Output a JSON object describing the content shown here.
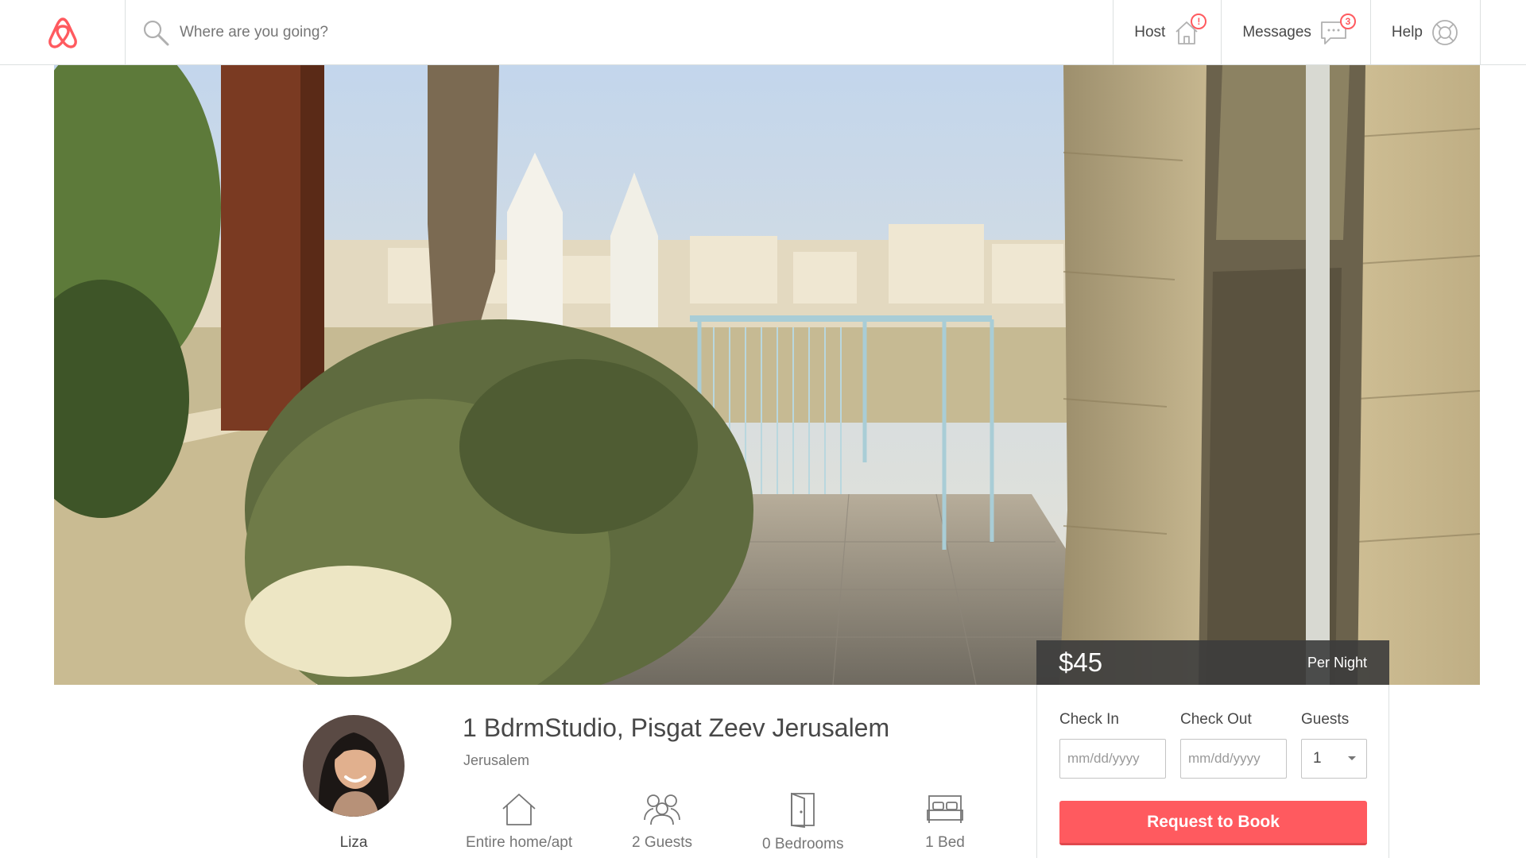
{
  "header": {
    "logo_icon": "airbnb-belo-icon",
    "search": {
      "placeholder": "Where are you going?",
      "value": "",
      "icon": "search-icon"
    },
    "nav": {
      "host": {
        "label": "Host",
        "icon": "house-icon",
        "badge": "!"
      },
      "messages": {
        "label": "Messages",
        "icon": "speech-bubble-icon",
        "badge": "3"
      },
      "help": {
        "label": "Help",
        "icon": "lifebuoy-icon"
      }
    }
  },
  "listing": {
    "title": "1 BdrmStudio, Pisgat Zeev Jerusalem",
    "location": "Jerusalem",
    "host_name": "Liza",
    "amenities": [
      {
        "label": "Entire home/apt",
        "icon": "home-icon"
      },
      {
        "label": "2 Guests",
        "icon": "guests-icon"
      },
      {
        "label": "0 Bedrooms",
        "icon": "door-icon"
      },
      {
        "label": "1 Bed",
        "icon": "bed-icon"
      }
    ]
  },
  "booking": {
    "price": "$45",
    "per_night": "Per Night",
    "check_in_label": "Check In",
    "check_out_label": "Check Out",
    "guests_label": "Guests",
    "date_placeholder": "mm/dd/yyyy",
    "guests_value": "1",
    "book_button": "Request to Book"
  },
  "colors": {
    "brand": "#ff5a5f",
    "text": "#484848",
    "muted": "#767676",
    "border": "#dce0e0"
  }
}
